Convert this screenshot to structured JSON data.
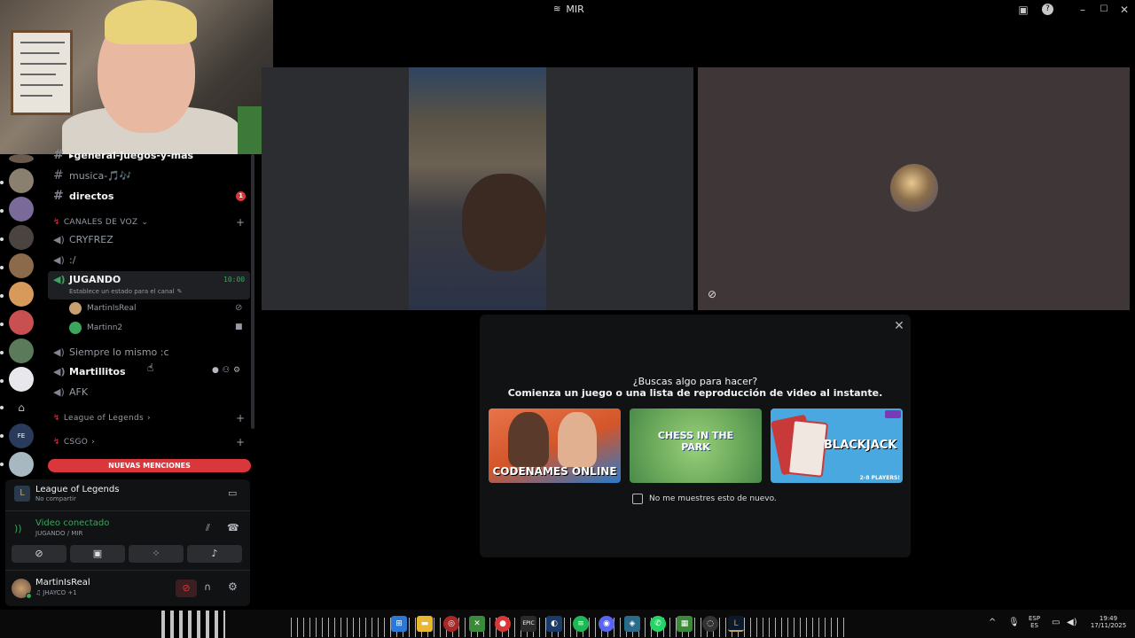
{
  "window": {
    "title": "MIR"
  },
  "channels": {
    "text": [
      {
        "label": "▸general-juegos-y-mas",
        "bold": true
      },
      {
        "label": "musica-🎵🎶",
        "bold": false
      },
      {
        "label": "directos",
        "bold": true,
        "badge": "1"
      }
    ],
    "voice_category": "CANALES DE VOZ",
    "voice": [
      {
        "label": "CRYFREZ"
      },
      {
        "label": ":/"
      },
      {
        "label": "JUGANDO",
        "timer": "10:00",
        "status": "Establece un estado para el canal"
      },
      {
        "label": "Siempre lo mismo :c"
      },
      {
        "label": "Martillitos"
      },
      {
        "label": "AFK"
      }
    ],
    "members": [
      {
        "name": "MartinIsReal",
        "color": "#c8a070"
      },
      {
        "name": "Martinn2",
        "color": "#3ba55d"
      }
    ],
    "categories": [
      {
        "label": "League of Legends"
      },
      {
        "label": "CSGO"
      }
    ],
    "mentions_label": "NUEVAS MENCIONES"
  },
  "activity": {
    "title": "League of Legends",
    "subtitle": "No compartir"
  },
  "voice_status": {
    "title": "Video conectado",
    "subtitle": "JUGANDO / MIR"
  },
  "user": {
    "name": "MartinIsReal",
    "status": "JHAYCO +1"
  },
  "stage": {
    "card_question": "¿Buscas algo para hacer?",
    "card_sub": "Comienza un juego o una lista de reproducción de video al instante.",
    "games": [
      {
        "title": "CODENAMES ONLINE"
      },
      {
        "title": "CHESS IN THE PARK"
      },
      {
        "title": "BLACKJACK",
        "badge": "2-8 PLAYERS!"
      }
    ],
    "checkbox_label": "No me muestres esto de nuevo."
  },
  "taskbar": {
    "lang_top": "ESP",
    "lang_bottom": "ES",
    "time": "19:49",
    "date": "17/11/2025"
  },
  "colors": {
    "accent_red": "#da373c",
    "accent_green": "#3ba55d"
  }
}
